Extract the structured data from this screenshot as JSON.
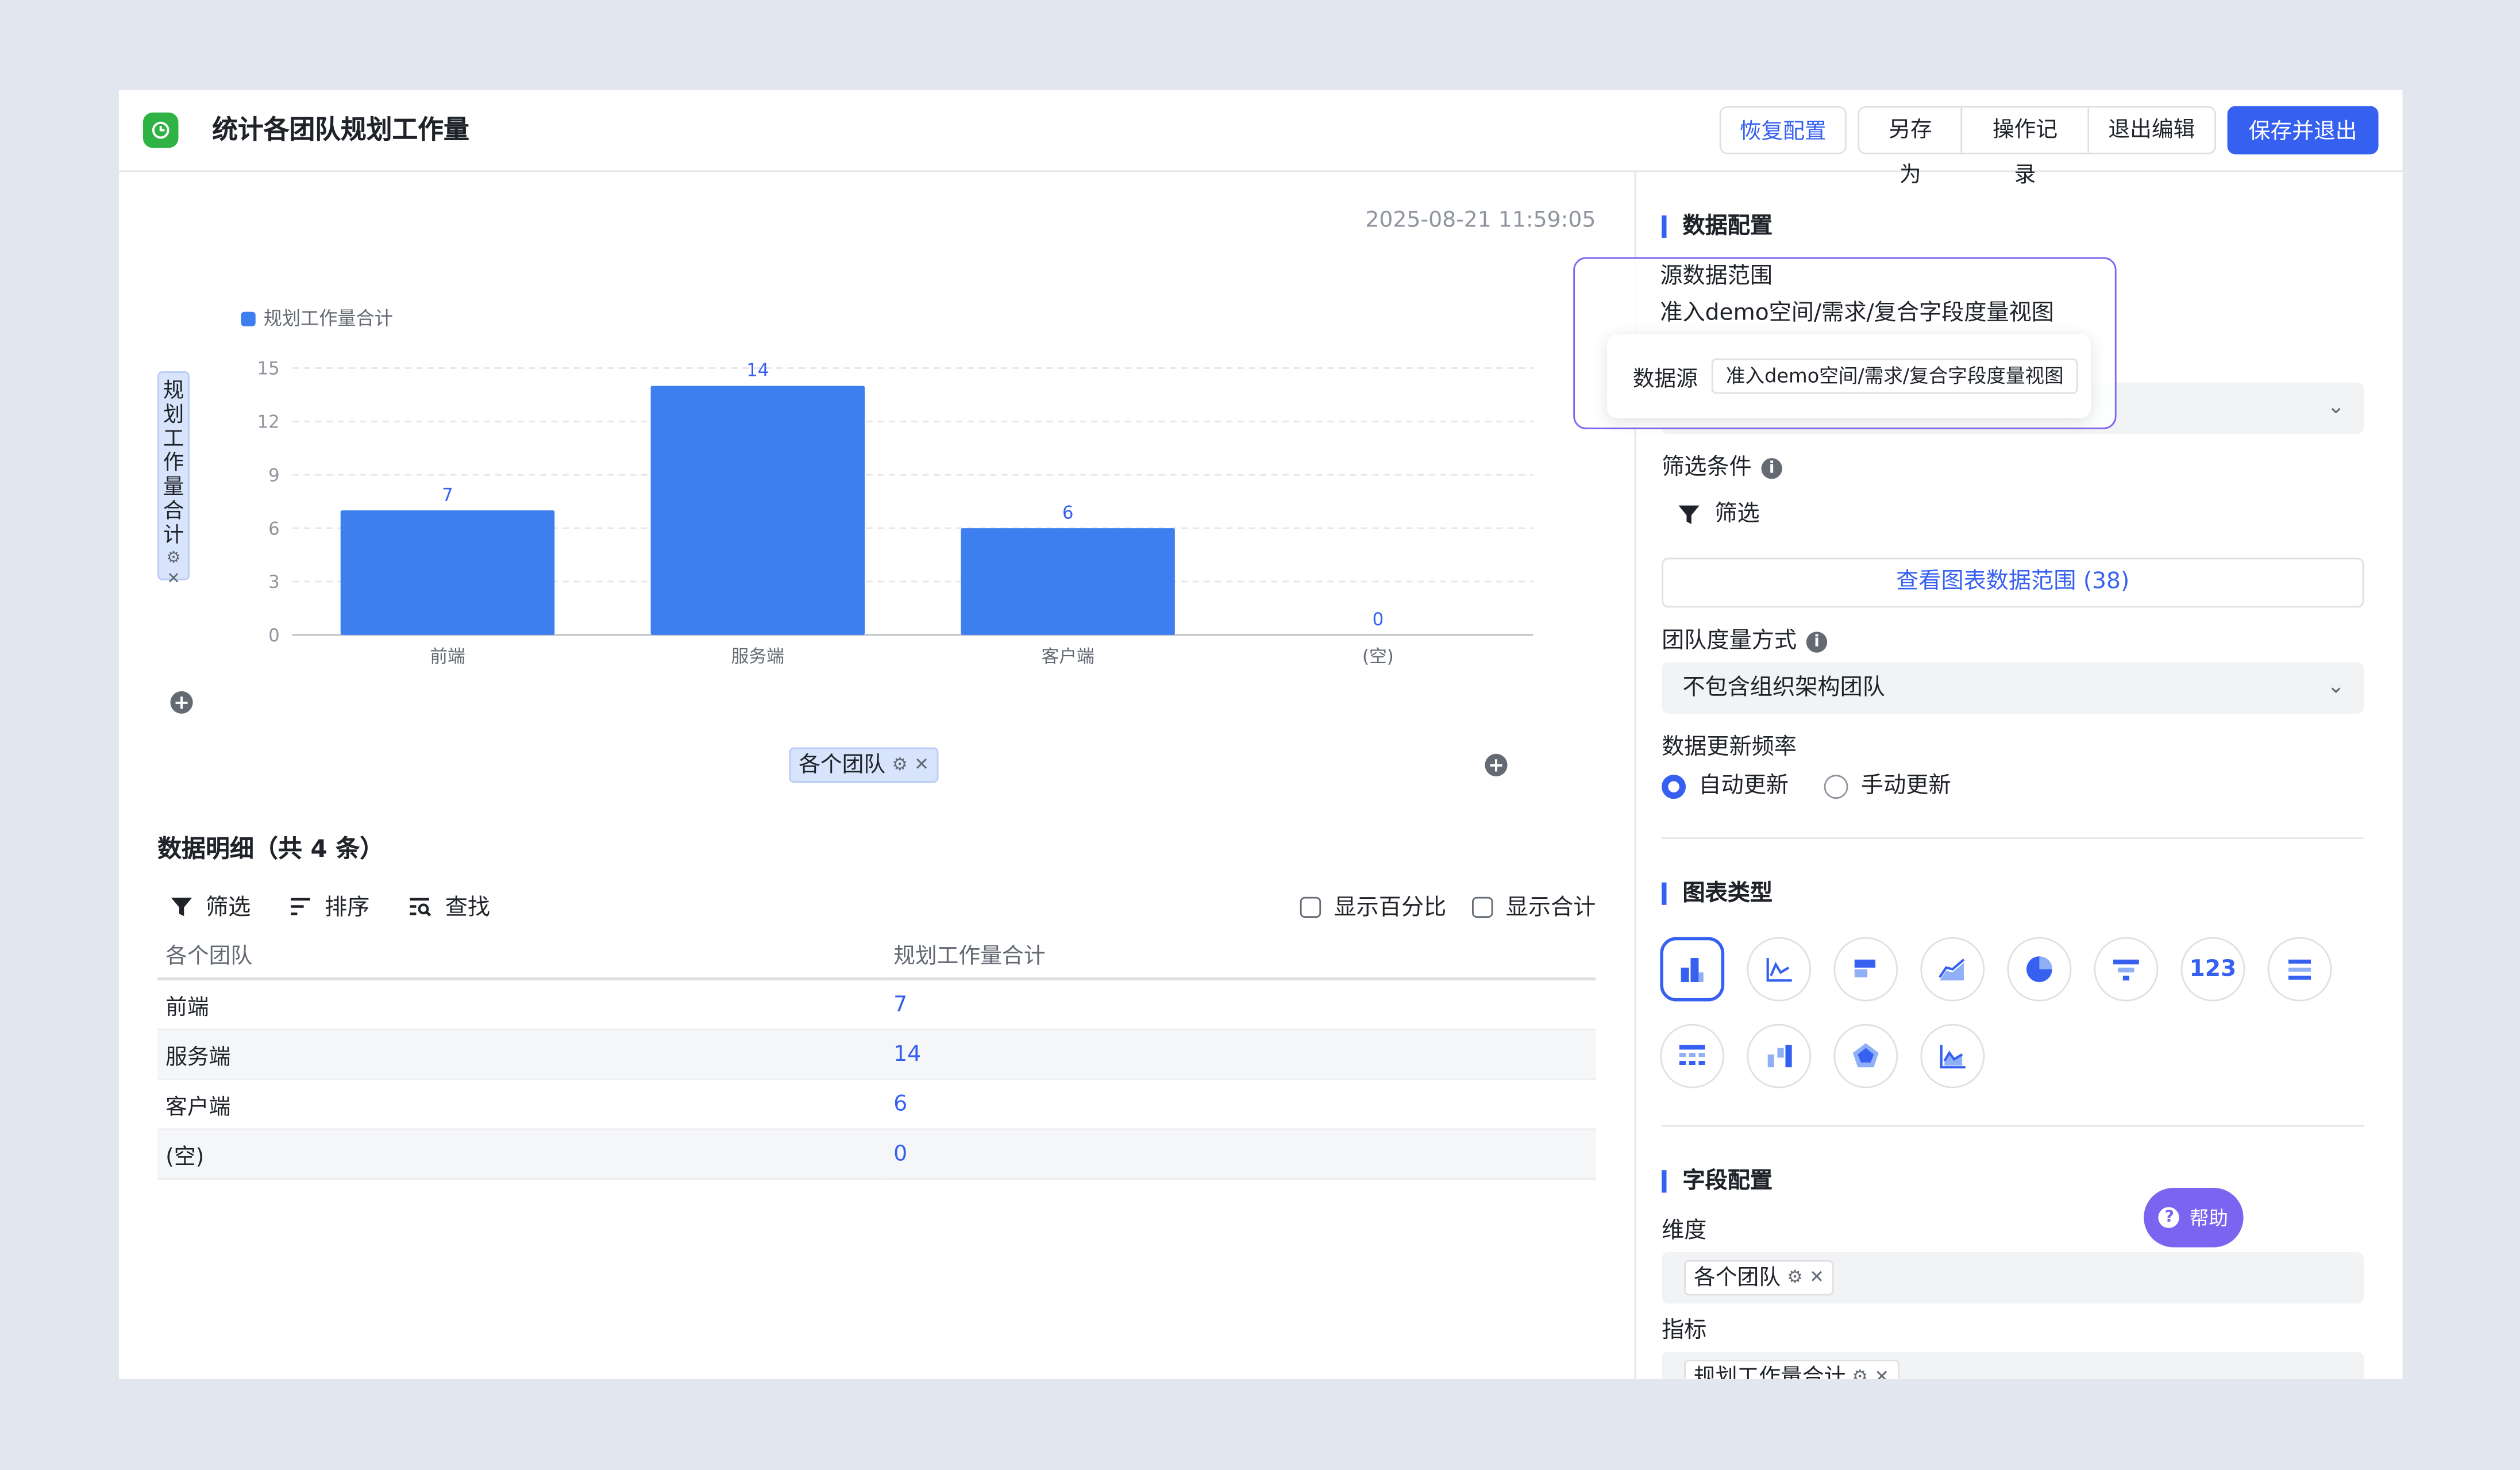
{
  "header": {
    "title": "统计各团队规划工作量",
    "restore_label": "恢复配置",
    "save_as_label": "另存为",
    "history_label": "操作记录",
    "exit_edit_label": "退出编辑",
    "save_exit_label": "保存并退出"
  },
  "canvas": {
    "timestamp": "2025-08-21 11:59:05",
    "y_field_pill": [
      "规",
      "划",
      "工",
      "作",
      "量",
      "合",
      "计"
    ],
    "x_field_pill": "各个团队",
    "icons": {
      "settings": "gear-icon",
      "remove": "close-icon",
      "add": "plus-circle-icon"
    }
  },
  "chart_data": {
    "type": "bar",
    "categories": [
      "前端",
      "服务端",
      "客户端",
      "(空)"
    ],
    "series": [
      {
        "name": "规划工作量合计",
        "values": [
          7,
          14,
          6,
          0
        ],
        "color": "#3e7ff0"
      }
    ],
    "ylim": [
      0,
      15
    ],
    "yticks": [
      0,
      3,
      6,
      9,
      12,
      15
    ],
    "xlabel": "各个团队",
    "ylabel": "规划工作量合计",
    "grid": true,
    "legend": "top-left",
    "data_labels": true
  },
  "detail": {
    "title": "数据明细（共 4 条）",
    "tools": {
      "filter": "筛选",
      "sort": "排序",
      "search": "查找"
    },
    "show_percent": "显示百分比",
    "show_total": "显示合计",
    "columns": [
      "各个团队",
      "规划工作量合计"
    ],
    "rows": [
      [
        "前端",
        "7"
      ],
      [
        "服务端",
        "14"
      ],
      [
        "客户端",
        "6"
      ],
      [
        "(空)",
        "0"
      ]
    ]
  },
  "config": {
    "data_section": "数据配置",
    "source_range_label": "源数据范围",
    "source_range_value": "准入demo空间/需求/复合字段度量视图",
    "data_source_label": "数据源",
    "data_source_value": "准入demo空间/需求/复合字段度量视图",
    "filter_cond_label": "筛选条件",
    "filter_btn": "筛选",
    "view_range_btn": "查看图表数据范围 (38)",
    "team_measure_label": "团队度量方式",
    "team_measure_value": "不包含组织架构团队",
    "update_freq_label": "数据更新频率",
    "auto_update": "自动更新",
    "manual_update": "手动更新",
    "chart_type_section": "图表类型",
    "chart_type_123": "123",
    "field_section": "字段配置",
    "dimension_label": "维度",
    "dimension_tag": "各个团队",
    "metric_label": "指标",
    "metric_tag": "规划工作量合计",
    "help_label": "帮助",
    "accent": "#3660f0",
    "popover_border": "#7b64f0"
  }
}
